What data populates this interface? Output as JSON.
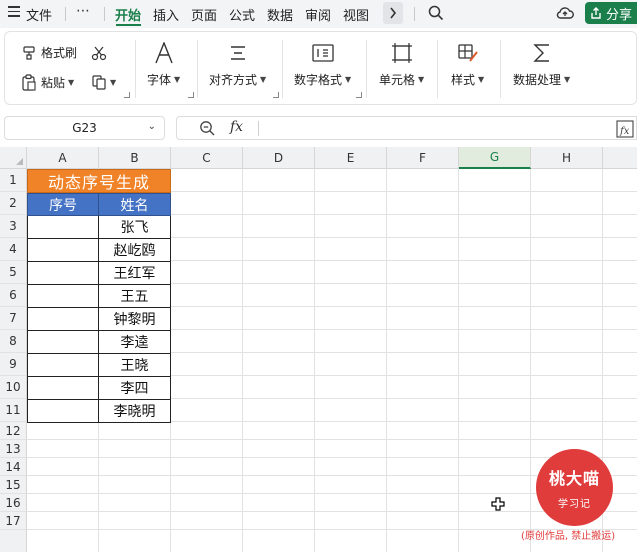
{
  "tabbar": {
    "file_label": "文件",
    "more": "⋯",
    "tabs": [
      "开始",
      "插入",
      "页面",
      "公式",
      "数据",
      "审阅",
      "视图"
    ],
    "active_tab": "开始",
    "share_label": "分享"
  },
  "ribbon": {
    "format_painter": "格式刷",
    "paste": "粘贴",
    "font": "字体",
    "align": "对齐方式",
    "number_format": "数字格式",
    "cell": "单元格",
    "style": "样式",
    "data_process": "数据处理"
  },
  "formula_bar": {
    "name_box": "G23",
    "fx": "fx",
    "content": ""
  },
  "grid": {
    "columns": [
      "A",
      "B",
      "C",
      "D",
      "E",
      "F",
      "G",
      "H"
    ],
    "selected_column": "G",
    "rows": [
      "1",
      "2",
      "3",
      "4",
      "5",
      "6",
      "7",
      "8",
      "9",
      "10",
      "11",
      "12",
      "13",
      "14",
      "15",
      "16",
      "17"
    ],
    "title": "动态序号生成",
    "headers": [
      "序号",
      "姓名"
    ],
    "names": [
      "张飞",
      "赵屹鸥",
      "王红军",
      "王五",
      "钟黎明",
      "李逵",
      "王晓",
      "李四",
      "李晓明"
    ]
  },
  "watermark": {
    "line1": "桃大喵",
    "line2": "学习记",
    "note": "(原创作品, 禁止搬运)",
    "color": "#e03c3c"
  },
  "colors": {
    "accent": "#1a7f4b",
    "title_fill": "#f08228",
    "header_fill": "#4472c4"
  }
}
